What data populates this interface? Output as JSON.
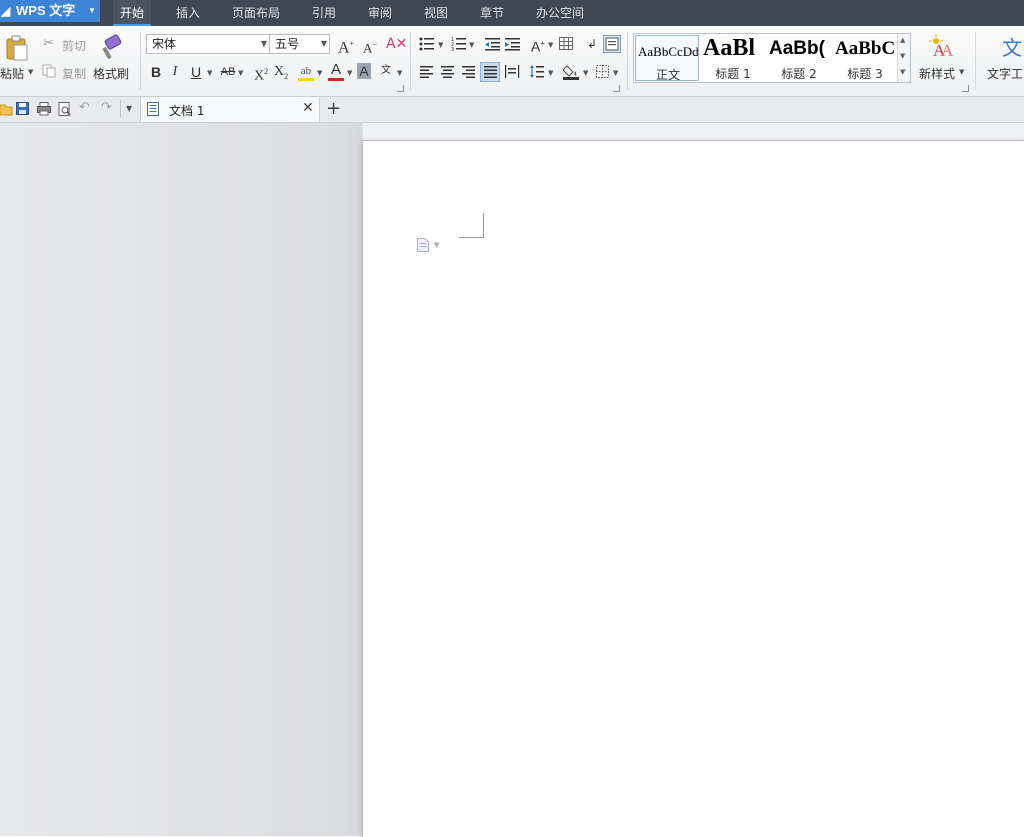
{
  "app": {
    "title": "WPS 文字"
  },
  "menu": {
    "tabs": [
      "开始",
      "插入",
      "页面布局",
      "引用",
      "审阅",
      "视图",
      "章节",
      "办公空间"
    ]
  },
  "ribbon": {
    "clipboard": {
      "paste": "粘贴",
      "cut": "剪切",
      "copy": "复制",
      "format_painter": "格式刷"
    },
    "font": {
      "name": "宋体",
      "size": "五号"
    },
    "styles": [
      {
        "preview": "AaBbCcDd",
        "name": "正文"
      },
      {
        "preview": "AaBl",
        "name": "标题 1"
      },
      {
        "preview": "AaBb(",
        "name": "标题 2"
      },
      {
        "preview": "AaBbC",
        "name": "标题 3"
      }
    ],
    "new_style": "新样式",
    "text_tools": "文字工"
  },
  "document_tab": {
    "title": "文档 1"
  },
  "colors": {
    "app_button": "#3d83d6",
    "menubar": "#3e4752",
    "highlight": "#ffd400",
    "font_color": "#e02020"
  }
}
